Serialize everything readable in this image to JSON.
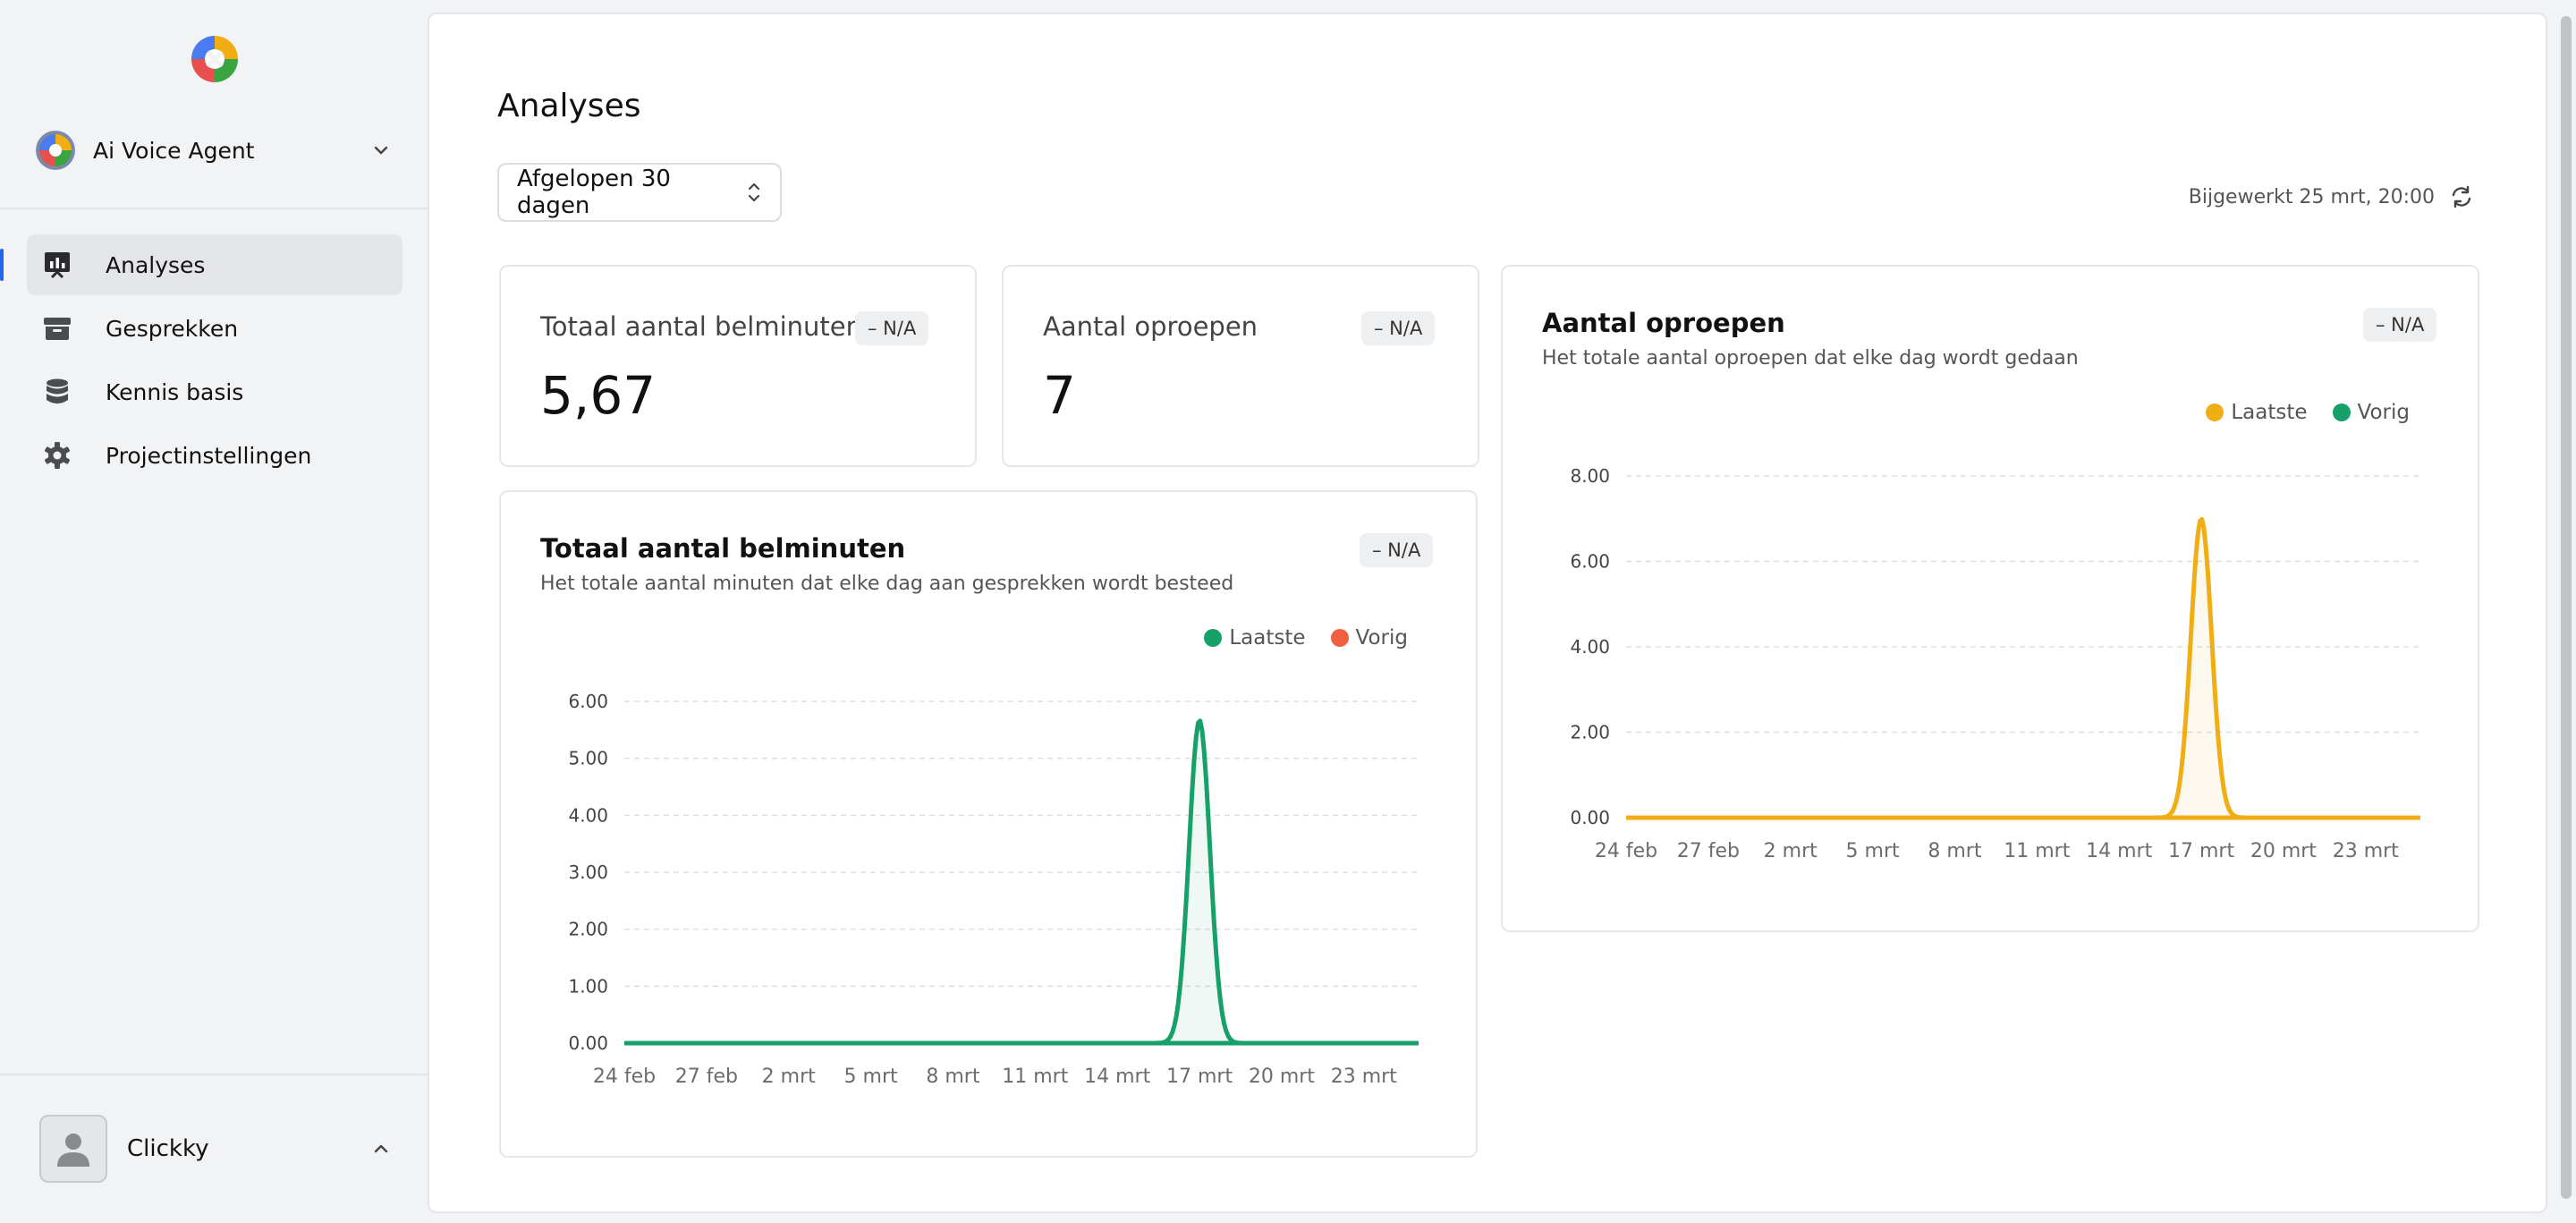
{
  "sidebar": {
    "workspace": {
      "name": "Ai Voice Agent"
    },
    "items": [
      {
        "label": "Analyses",
        "icon": "analytics-icon",
        "active": true
      },
      {
        "label": "Gesprekken",
        "icon": "archive-icon",
        "active": false
      },
      {
        "label": "Kennis basis",
        "icon": "database-icon",
        "active": false
      },
      {
        "label": "Projectinstellingen",
        "icon": "gear-icon",
        "active": false
      }
    ],
    "user": {
      "name": "Clickky"
    }
  },
  "main": {
    "title": "Analyses",
    "range": {
      "selected": "Afgelopen 30 dagen"
    },
    "updated": "Bijgewerkt 25 mrt, 20:00"
  },
  "cards": {
    "minutes_stat": {
      "label": "Totaal aantal belminuten",
      "value": "5,67",
      "badge": "– N/A"
    },
    "calls_stat": {
      "label": "Aantal oproepen",
      "value": "7",
      "badge": "– N/A"
    }
  },
  "chart_data": [
    {
      "type": "area",
      "title": "Totaal aantal belminuten",
      "subtitle": "Het totale aantal minuten dat elke dag aan gesprekken wordt besteed",
      "badge": "– N/A",
      "x_ticks": [
        "24 feb",
        "27 feb",
        "2 mrt",
        "5 mrt",
        "8 mrt",
        "11 mrt",
        "14 mrt",
        "17 mrt",
        "20 mrt",
        "23 mrt"
      ],
      "y_ticks": [
        "0.00",
        "1.00",
        "2.00",
        "3.00",
        "4.00",
        "5.00",
        "6.00"
      ],
      "ylim": [
        0,
        6
      ],
      "x_days": 30,
      "legend_position": "top-right",
      "series": [
        {
          "name": "Laatste",
          "color": "#16a06a",
          "peak_day": 21,
          "peak_value": 5.67
        },
        {
          "name": "Vorig",
          "color": "#f06040",
          "peak_day": 21,
          "peak_value": 0
        }
      ]
    },
    {
      "type": "area",
      "title": "Aantal oproepen",
      "subtitle": "Het totale aantal oproepen dat elke dag wordt gedaan",
      "badge": "– N/A",
      "x_ticks": [
        "24 feb",
        "27 feb",
        "2 mrt",
        "5 mrt",
        "8 mrt",
        "11 mrt",
        "14 mrt",
        "17 mrt",
        "20 mrt",
        "23 mrt"
      ],
      "y_ticks": [
        "0.00",
        "2.00",
        "4.00",
        "6.00",
        "8.00"
      ],
      "ylim": [
        0,
        8
      ],
      "x_days": 30,
      "legend_position": "top-right",
      "series": [
        {
          "name": "Laatste",
          "color": "#f0ad14",
          "peak_day": 21,
          "peak_value": 7
        },
        {
          "name": "Vorig",
          "color": "#16a06a",
          "peak_day": 21,
          "peak_value": 0
        }
      ]
    }
  ]
}
